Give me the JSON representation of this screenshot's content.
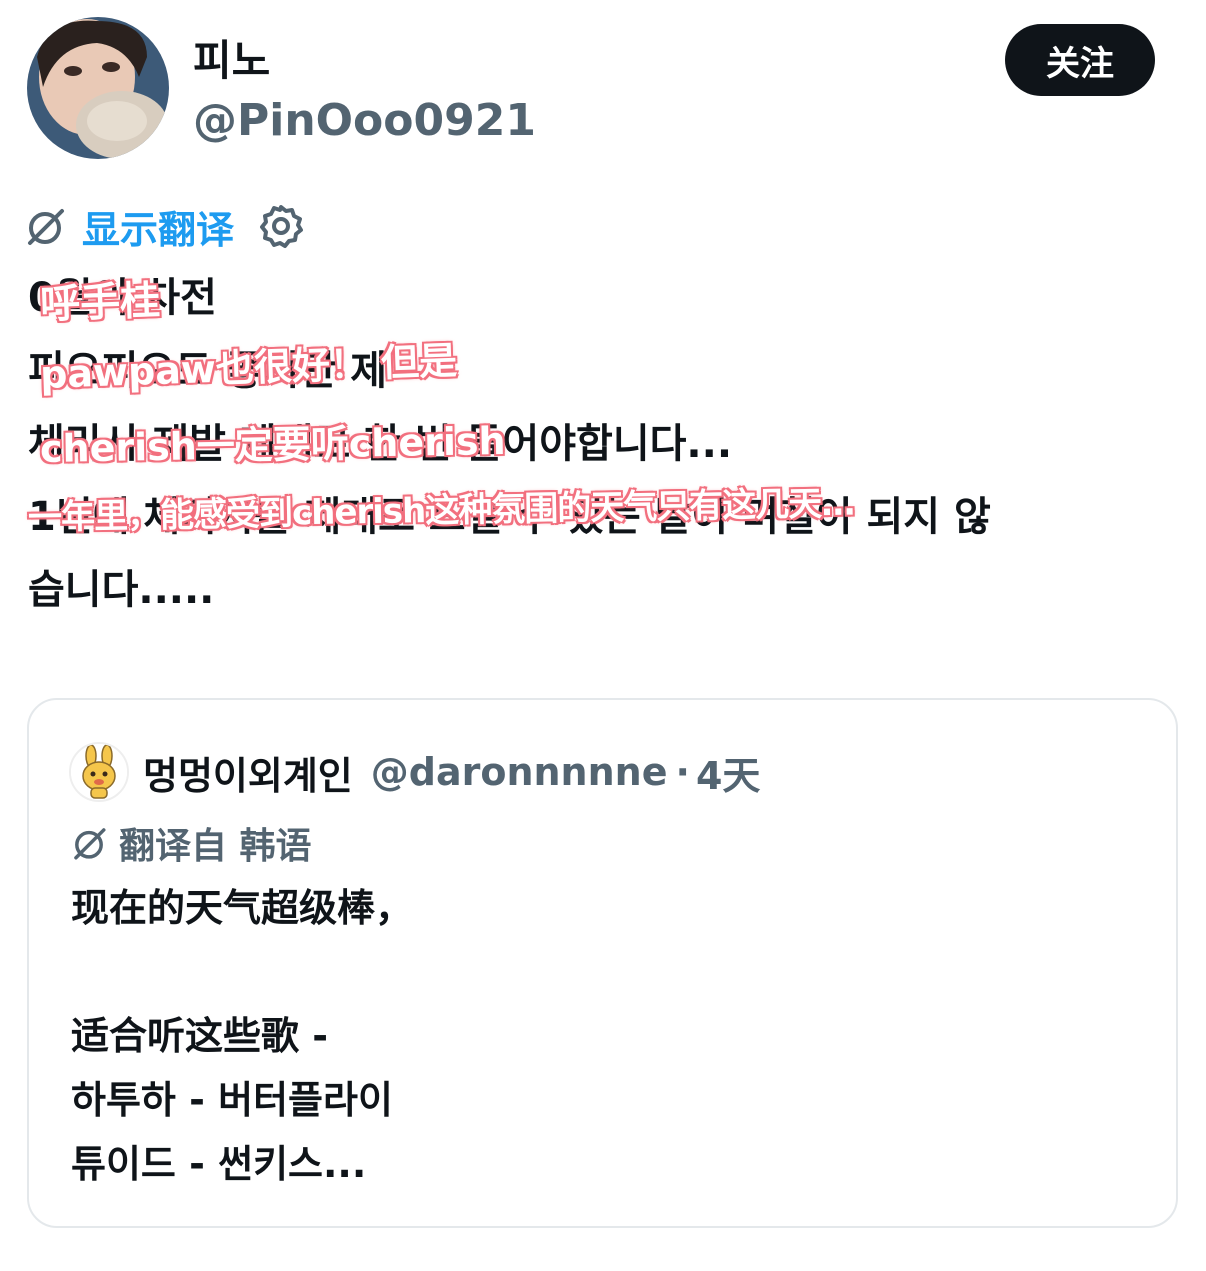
{
  "author": {
    "display_name": "피노",
    "handle": "@PinOoo0921",
    "follow_label": "关注"
  },
  "translation": {
    "show_label": "显示翻译"
  },
  "tweet": {
    "lines": [
      "0월의 차전",
      "피오피오도 좋지만 제",
      "체리시 제발 제대로 한 번 들어야합니다...",
      "1년에 체리시를 제대로 느낄 수 있는 날이 며칠이 되지 않",
      "습니다....."
    ]
  },
  "overlay_text": {
    "line1": "呼手桂",
    "line2": "pawpaw也很好！ 但是",
    "line3": "cherish一定要听cherish",
    "line4": "一年里，能感受到cherish这种氛围的天气只有这几天…"
  },
  "quote": {
    "display_name": "멍멍이외계인",
    "handle": "@daronnnnne",
    "separator": "·",
    "time": "4天",
    "translated_from": "翻译自 韩语",
    "lines": [
      "现在的天气超级棒，",
      "",
      "适合听这些歌 -",
      "하투하 - 버터플라이",
      "튜이드 - 썬키스..."
    ]
  },
  "colors": {
    "link_blue": "#1d9bf0",
    "secondary_gray": "#536471",
    "overlay_pink": "#f2707f",
    "follow_bg": "#0f1419"
  }
}
